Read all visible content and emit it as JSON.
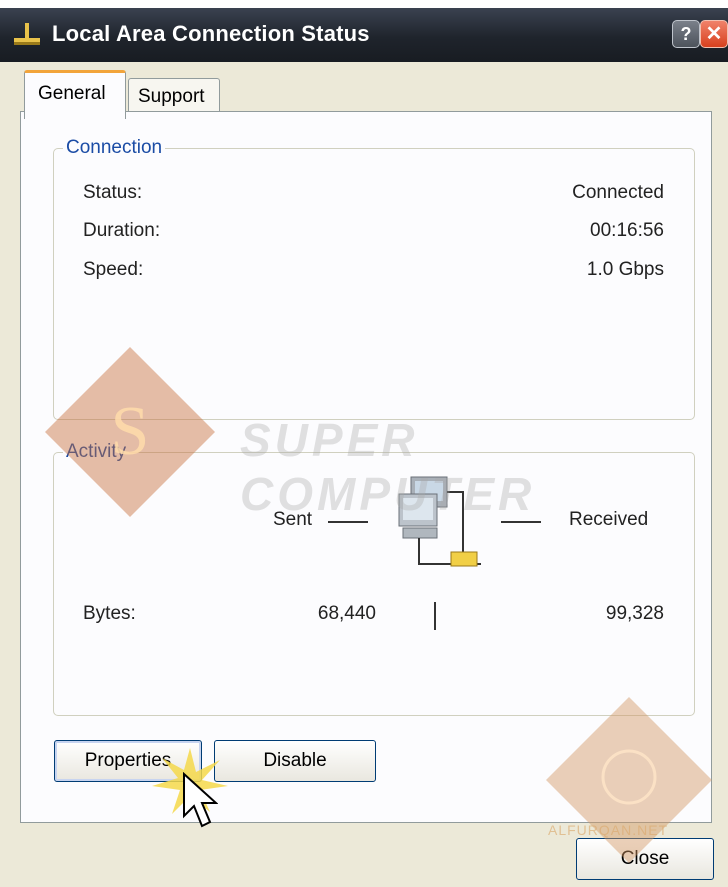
{
  "window": {
    "title": "Local Area Connection Status",
    "help_glyph": "?",
    "close_glyph": "✕"
  },
  "tabs": [
    {
      "label": "General",
      "active": true
    },
    {
      "label": "Support",
      "active": false
    }
  ],
  "connection": {
    "group_title": "Connection",
    "rows": [
      {
        "label": "Status:",
        "value": "Connected"
      },
      {
        "label": "Duration:",
        "value": "00:16:56"
      },
      {
        "label": "Speed:",
        "value": "1.0 Gbps"
      }
    ]
  },
  "activity": {
    "group_title": "Activity",
    "sent_label": "Sent",
    "received_label": "Received",
    "bytes_label": "Bytes:",
    "bytes_sent": "68,440",
    "bytes_received": "99,328"
  },
  "buttons": {
    "properties": "Properties",
    "disable": "Disable",
    "close": "Close"
  },
  "watermark": {
    "logo_letter": "S",
    "text": "SUPER COMPUTER",
    "bottom_text": "ALFURQAN.NET"
  },
  "colors": {
    "titlebar": "#1f242c",
    "group_title": "#1b4ca5",
    "tab_highlight": "#f2a43a",
    "close_button": "#d8401e"
  }
}
